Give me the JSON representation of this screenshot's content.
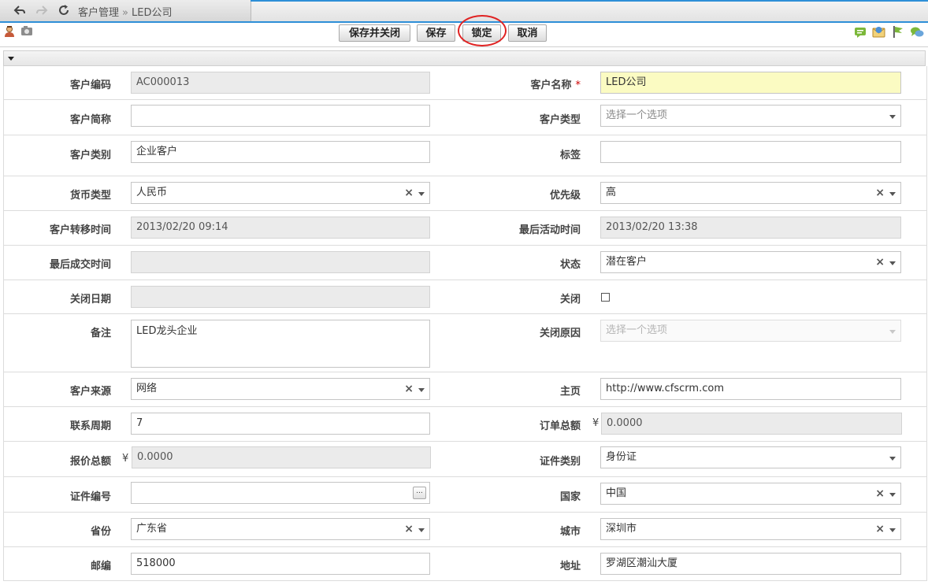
{
  "breadcrumb": {
    "parent": "客户管理",
    "separator": "»",
    "current": "LED公司"
  },
  "toolbar": {
    "save_close_label": "保存并关闭",
    "save_label": "保存",
    "lock_label": "锁定",
    "cancel_label": "取消"
  },
  "icons": {
    "back": "back-arrow-icon",
    "forward": "forward-arrow-icon",
    "refresh": "refresh-icon",
    "user": "user-icon",
    "camera": "camera-icon",
    "message": "message-icon",
    "email": "email-icon",
    "flag": "flag-icon",
    "chat": "chat-icon"
  },
  "colors": {
    "accent": "#2e8fd7",
    "highlight": "#e02222",
    "required_bg": "#fbfbc2"
  },
  "form": {
    "customer_code": {
      "label": "客户编码",
      "value": "AC000013"
    },
    "customer_name": {
      "label": "客户名称",
      "required": "*",
      "value": "LED公司"
    },
    "short_name": {
      "label": "客户简称",
      "value": ""
    },
    "customer_type": {
      "label": "客户类型",
      "placeholder": "选择一个选项"
    },
    "customer_category": {
      "label": "客户类别",
      "value": "企业客户"
    },
    "tags": {
      "label": "标签",
      "value": ""
    },
    "currency": {
      "label": "货币类型",
      "value": "人民币"
    },
    "priority": {
      "label": "优先级",
      "value": "高"
    },
    "transfer_time": {
      "label": "客户转移时间",
      "value": "2013/02/20 09:14"
    },
    "last_activity": {
      "label": "最后活动时间",
      "value": "2013/02/20 13:38"
    },
    "last_deal": {
      "label": "最后成交时间",
      "value": ""
    },
    "status": {
      "label": "状态",
      "value": "潜在客户"
    },
    "close_date": {
      "label": "关闭日期",
      "value": ""
    },
    "closed": {
      "label": "关闭",
      "checked": false
    },
    "remark": {
      "label": "备注",
      "value": "LED龙头企业"
    },
    "close_reason": {
      "label": "关闭原因",
      "placeholder": "选择一个选项"
    },
    "source": {
      "label": "客户来源",
      "value": "网络"
    },
    "homepage": {
      "label": "主页",
      "value": "http://www.cfscrm.com"
    },
    "contact_cycle": {
      "label": "联系周期",
      "value": "7"
    },
    "order_total": {
      "label": "订单总额",
      "currency": "¥",
      "value": "0.0000"
    },
    "quote_total": {
      "label": "报价总额",
      "currency": "¥",
      "value": "0.0000"
    },
    "id_type": {
      "label": "证件类别",
      "value": "身份证"
    },
    "id_number": {
      "label": "证件编号",
      "value": "",
      "button": "..."
    },
    "country": {
      "label": "国家",
      "value": "中国"
    },
    "province": {
      "label": "省份",
      "value": "广东省"
    },
    "city": {
      "label": "城市",
      "value": "深圳市"
    },
    "postcode": {
      "label": "邮编",
      "value": "518000"
    },
    "address": {
      "label": "地址",
      "value": "罗湖区潮汕大厦"
    }
  },
  "select_clear_glyph": "×"
}
